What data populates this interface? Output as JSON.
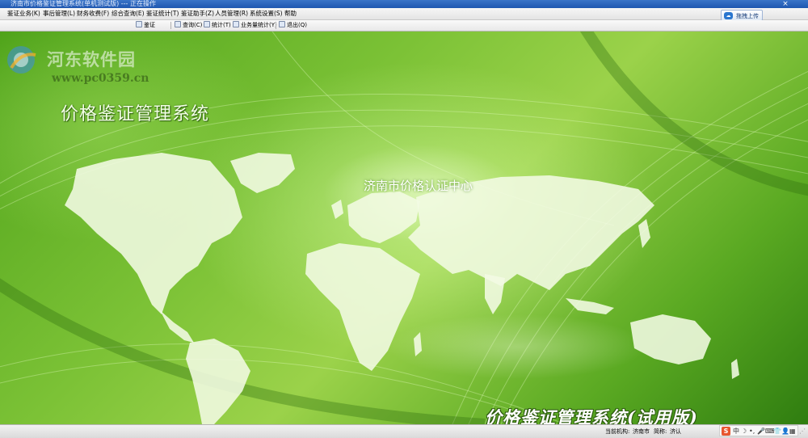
{
  "window": {
    "title": "济南市价格鉴证管理系统(单机测试版) --- 正在操作"
  },
  "menu": {
    "items": [
      "鉴证业务(K)",
      "事后管理(L)",
      "财务收费(F)",
      "综合查询(E)",
      "鉴证统计(T)",
      "鉴证助手(Z)",
      "人员管理(R)",
      "系统设置(S)",
      "帮助"
    ]
  },
  "upload_button": {
    "label": "拖拽上传",
    "icon": "cloud-upload-icon"
  },
  "toolbar": {
    "items": [
      {
        "label": "鉴证",
        "icon": "document-icon"
      },
      {
        "label": "查询(C)",
        "icon": "search-icon"
      },
      {
        "label": "统计(T)",
        "icon": "chart-icon"
      },
      {
        "label": "业务量统计(Y)",
        "icon": "stats-icon"
      },
      {
        "label": "退出(Q)",
        "icon": "exit-icon"
      }
    ]
  },
  "watermark": {
    "name": "河东软件园",
    "site": "www.pc0359.cn"
  },
  "main": {
    "system_title": "价格鉴证管理系统",
    "center_name": "济南市价格认证中心",
    "trial_title": "价格鉴证管理系统(试用版)"
  },
  "statusbar": {
    "org_label": "当前机构:",
    "org_value": "济南市",
    "abbr_label": "简称:",
    "abbr_value": "济认"
  },
  "ime": {
    "logo": "S",
    "icons": [
      "中",
      "☽",
      "•,",
      "🎤",
      "⌨",
      "👕",
      "👤",
      "▦"
    ]
  },
  "colors": {
    "background_green": "#7cc236",
    "titlebar_blue": "#1f57b0",
    "ime_orange": "#e8552e"
  }
}
